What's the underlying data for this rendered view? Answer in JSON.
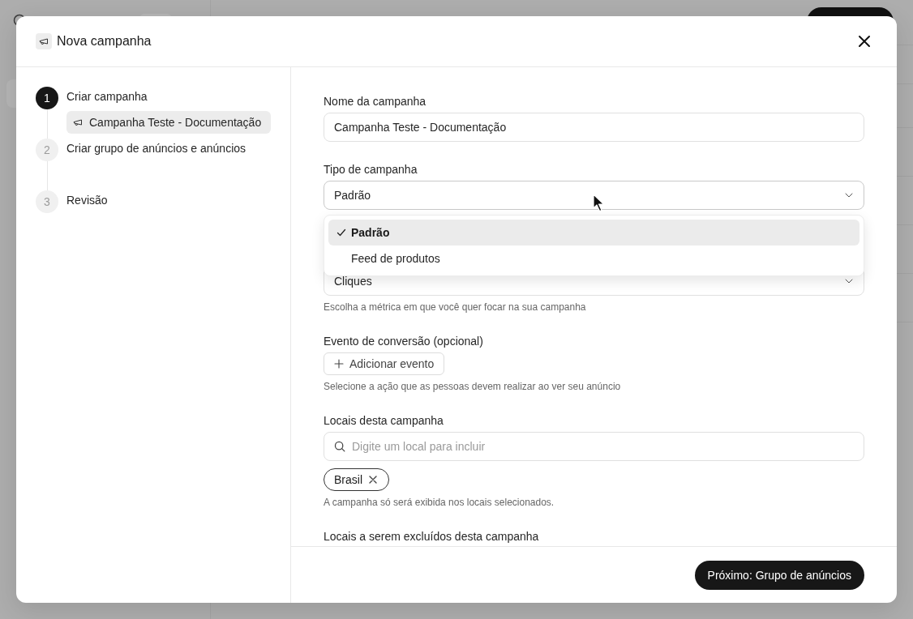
{
  "dialog": {
    "title": "Nova campanha",
    "steps": [
      {
        "number": "1",
        "label": "Criar campanha",
        "selected": true,
        "children": [
          {
            "label": "Campanha Teste - Documentação"
          }
        ]
      },
      {
        "number": "2",
        "label": "Criar grupo de anúncios e anúncios",
        "selected": false
      },
      {
        "number": "3",
        "label": "Revisão",
        "selected": false
      }
    ],
    "form": {
      "fields": [
        {
          "kind": "text",
          "label": "Nome da campanha",
          "value": "Campanha Teste - Documentação"
        },
        {
          "kind": "select",
          "label": "Tipo de campanha",
          "value": "Padrão",
          "expanded": true,
          "options": [
            {
              "label": "Padrão",
              "selected": true
            },
            {
              "label": "Feed de produtos",
              "selected": false
            }
          ]
        },
        {
          "kind": "select",
          "value": "Cliques",
          "expanded": false,
          "helper": "Escolha a métrica em que você quer focar na sua campanha"
        },
        {
          "kind": "button",
          "label": "Evento de conversão (opcional)",
          "button_label": "Adicionar evento",
          "helper": "Selecione a ação que as pessoas devem realizar ao ver seu anúncio"
        },
        {
          "kind": "search",
          "label": "Locais desta campanha",
          "placeholder": "Digite um local para incluir",
          "tags": [
            {
              "label": "Brasil"
            }
          ],
          "helper": "A campanha só será exibida nos locais selecionados."
        },
        {
          "kind": "heading",
          "label": "Locais a serem excluídos desta campanha"
        }
      ]
    },
    "next_button": "Próximo: Grupo de anúncios"
  }
}
